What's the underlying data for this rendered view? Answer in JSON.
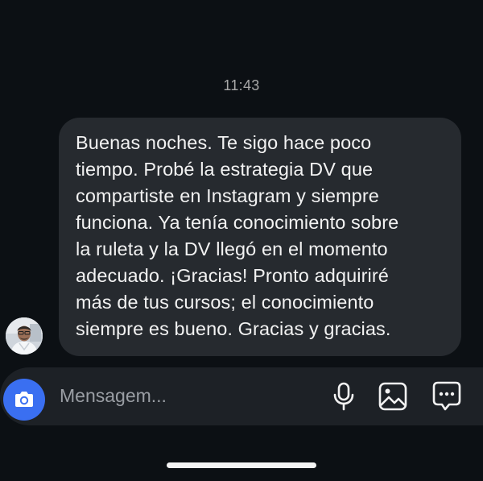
{
  "conversation": {
    "timestamp": "11:43",
    "message": {
      "lines": [
        "Buenas noches. Te sigo hace poco",
        "tiempo. Probé la estrategia DV que",
        "compartiste en Instagram y siempre",
        "funciona. Ya tenía conocimiento sobre",
        "la ruleta y la DV llegó en el momento",
        "adecuado. ¡Gracias! Pronto adquiriré",
        "más de tus cursos; el conocimiento",
        "siempre es bueno. Gracias y gracias."
      ],
      "bubble_color": "#262a2f"
    },
    "avatar_icon": "user-avatar"
  },
  "composer": {
    "placeholder": "Mensagem...",
    "camera_icon": "camera-icon",
    "camera_color": "#3a6ff1",
    "icons": [
      "microphone-icon",
      "image-icon",
      "sticker-icon"
    ]
  },
  "theme": {
    "background": "#0c1014",
    "composer_background": "#1d2126"
  }
}
